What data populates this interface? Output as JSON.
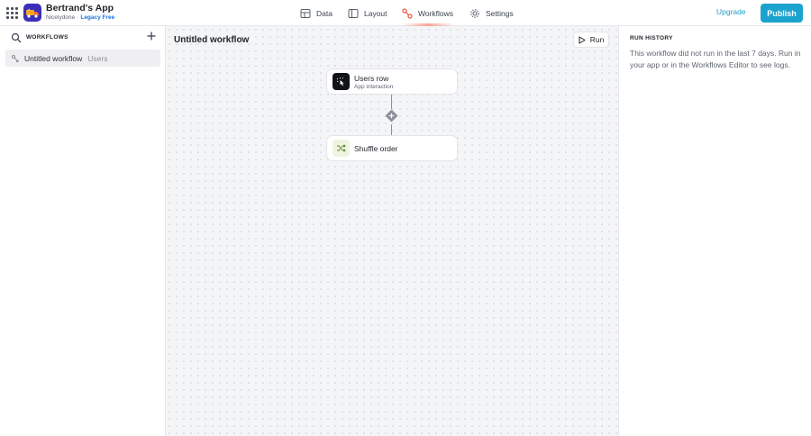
{
  "app": {
    "name": "Bertrand's App",
    "workspace": "Nicelydone",
    "separator": "·",
    "plan": "Legacy Free",
    "brand_color": "#3b2fb8"
  },
  "nav": {
    "tabs": [
      {
        "label": "Data",
        "icon": "database-icon"
      },
      {
        "label": "Layout",
        "icon": "layout-icon"
      },
      {
        "label": "Workflows",
        "icon": "workflows-icon",
        "active": true
      },
      {
        "label": "Settings",
        "icon": "gear-icon"
      }
    ],
    "upgrade_label": "Upgrade",
    "publish_label": "Publish",
    "accent_color": "#1aa3cf"
  },
  "sidebar": {
    "title": "WORKFLOWS",
    "items": [
      {
        "label": "Untitled workflow",
        "trigger": "Users",
        "selected": true
      }
    ]
  },
  "canvas": {
    "title": "Untitled workflow",
    "run_label": "Run",
    "nodes": [
      {
        "title": "Users row",
        "subtitle": "App interaction",
        "icon": "tap-icon"
      },
      {
        "title": "Shuffle order",
        "subtitle": "",
        "icon": "shuffle-icon"
      }
    ]
  },
  "run_history": {
    "title": "RUN HISTORY",
    "message": "This workflow did not run in the last 7 days. Run in your app or in the Workflows Editor to see logs."
  }
}
